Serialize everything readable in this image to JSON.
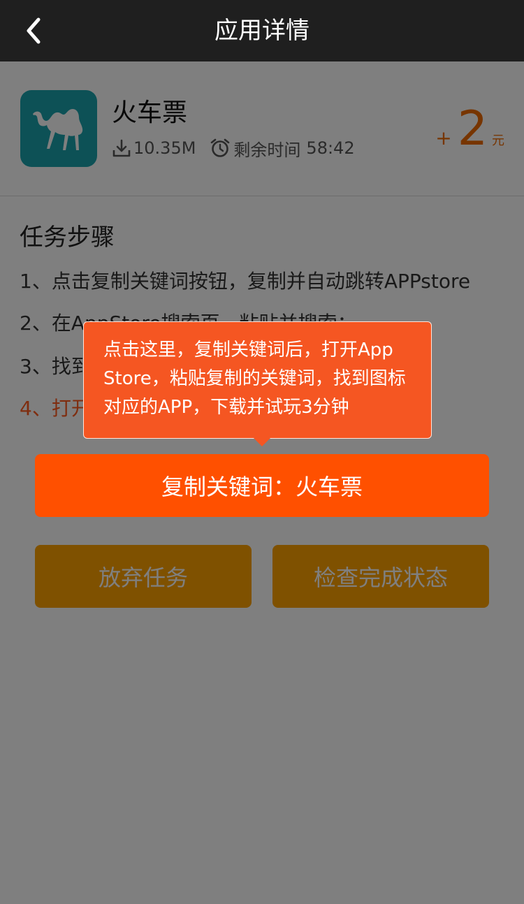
{
  "nav": {
    "title": "应用详情",
    "back_icon": "chevron-left-icon"
  },
  "app": {
    "name": "火车票",
    "size": "10.35M",
    "remaining_label": "剩余时间",
    "remaining_time": "58:42",
    "reward": {
      "plus": "+",
      "amount": "2",
      "unit": "元"
    },
    "icon_bg": "#1aa3ad"
  },
  "steps": {
    "title": "任务步骤",
    "items": [
      "1、点击复制关键词按钮，复制并自动跳转APPstore",
      "2、在AppStore搜索页，粘贴并搜索；",
      "3、找到",
      "4、打开"
    ]
  },
  "tooltip": {
    "text": "点击这里，复制关键词后，打开App Store，粘贴复制的关键词，找到图标对应的APP，下载并试玩3分钟"
  },
  "buttons": {
    "copy_keyword": "复制关键词：火车票",
    "abandon": "放弃任务",
    "check_status": "检查完成状态"
  },
  "colors": {
    "nav_bg": "#1f1f1f",
    "accent": "#ff5000",
    "secondary_button": "#ffa300",
    "reward": "#ef6a00",
    "overlay": "rgba(0,0,0,0.5)"
  }
}
